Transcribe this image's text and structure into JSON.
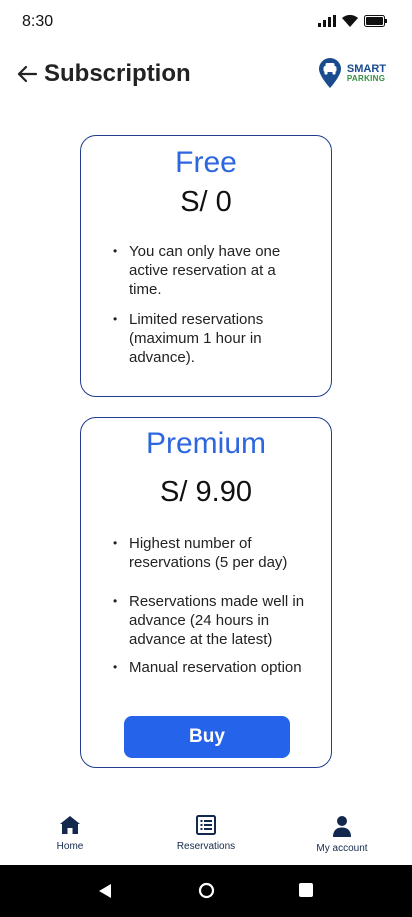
{
  "status_bar": {
    "time": "8:30",
    "icons": [
      "signal-icon",
      "wifi-icon",
      "battery-icon"
    ]
  },
  "header": {
    "title": "Subscription",
    "logo": {
      "line1": "SMART",
      "line2": "PARKING"
    }
  },
  "colors": {
    "accent": "#2d67e0",
    "button": "#2563eb",
    "card_border": "#1f3f8c",
    "logo_blue": "#1a4b8f",
    "logo_green": "#2f8f3c"
  },
  "plans": {
    "free": {
      "name": "Free",
      "price": "S/ 0",
      "features": [
        "You can only have one active reservation at a time.",
        "Limited reservations (maximum 1 hour in advance)."
      ]
    },
    "premium": {
      "name": "Premium",
      "price": "S/ 9.90",
      "features": [
        "Highest number of reservations (5 per day)",
        "Reservations made well in advance (24 hours in advance at the latest)",
        "Manual reservation option"
      ],
      "button_label": "Buy"
    }
  },
  "bottom_nav": {
    "home": "Home",
    "reservations": "Reservations",
    "account": "My account"
  }
}
